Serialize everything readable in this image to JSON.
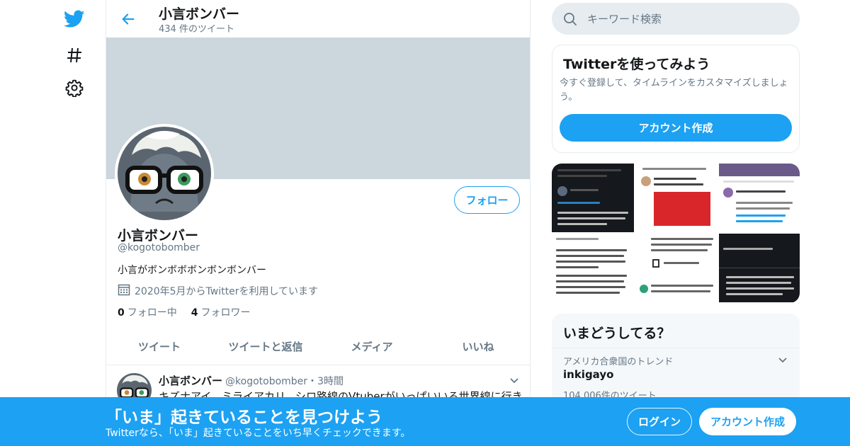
{
  "colors": {
    "accent": "#1da1f2",
    "text_primary": "#14171a",
    "text_secondary": "#657786",
    "banner": "#ccd6dd",
    "border": "#e6ecf0"
  },
  "nav": {
    "items": [
      {
        "icon": "twitter-bird-icon"
      },
      {
        "icon": "hashtag-icon"
      },
      {
        "icon": "gear-icon"
      }
    ]
  },
  "header": {
    "title": "小言ボンバー",
    "tweet_count": "434 件のツイート"
  },
  "profile": {
    "name": "小言ボンバー",
    "handle": "@kogotobomber",
    "bio": "小言がボンボボボンボンボンバー",
    "joined": "2020年5月からTwitterを利用しています",
    "following_count": "0",
    "following_label": "フォロー中",
    "followers_count": "4",
    "followers_label": "フォロワー",
    "follow_button": "フォロー"
  },
  "tabs": [
    {
      "label": "ツイート"
    },
    {
      "label": "ツイートと返信"
    },
    {
      "label": "メディア"
    },
    {
      "label": "いいね"
    }
  ],
  "tweet": {
    "name": "小言ボンバー",
    "handle_time": "@kogotobomber・3時間",
    "text": "キズナアイ、ミライアカリ、シロ路線のVtuberがいっぱいいる世界線に行き"
  },
  "search": {
    "placeholder": "キーワード検索"
  },
  "signup_box": {
    "title": "Twitterを使ってみよう",
    "description": "今すぐ登録して、タイムラインをカスタマイズしましょう。",
    "button": "アカウント作成"
  },
  "trends": {
    "title": "いまどうしてる？",
    "items": [
      {
        "location": "アメリカ合衆国のトレンド",
        "name": "inkigayo",
        "count": "104,006件のツイート"
      }
    ]
  },
  "bottom_bar": {
    "title": "「いま」起きていることを見つけよう",
    "subtitle": "Twitterなら、「いま」起きていることをいち早くチェックできます。",
    "login": "ログイン",
    "signup": "アカウント作成"
  }
}
